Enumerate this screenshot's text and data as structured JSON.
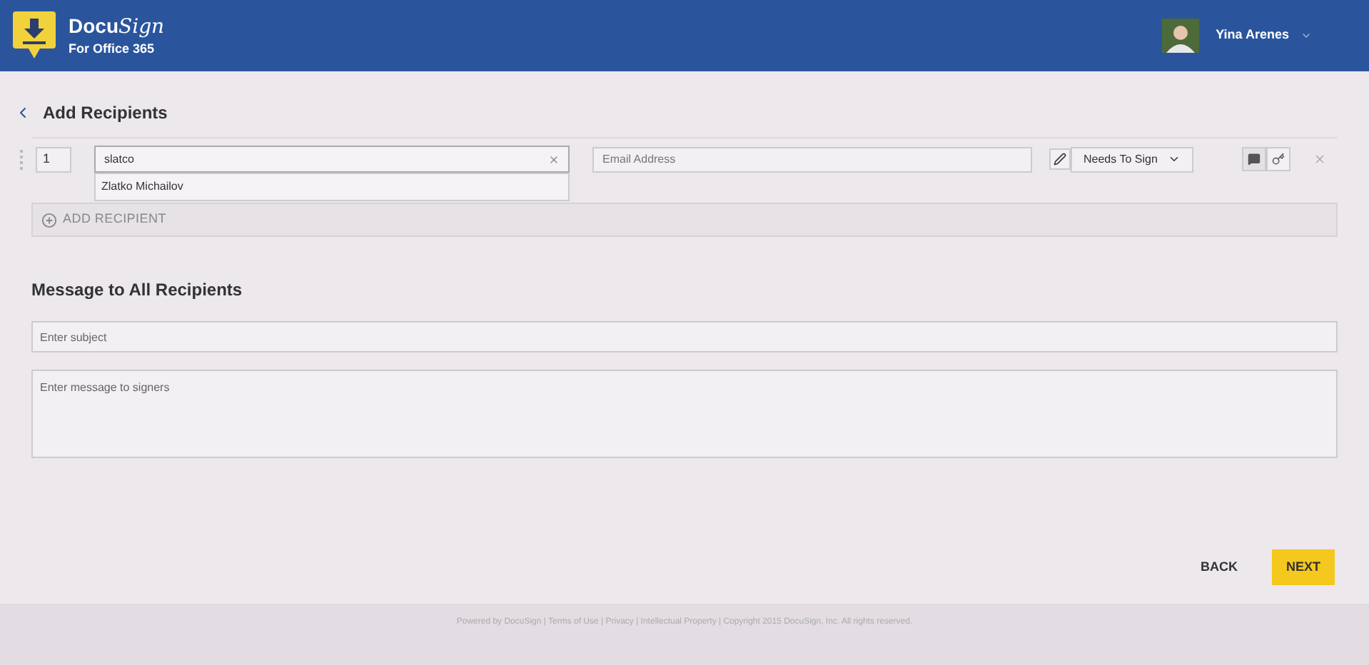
{
  "header": {
    "brand": "Docu",
    "brand_script": "Sign",
    "subtitle": "For Office 365",
    "user": "Yina Arenes"
  },
  "page_title": "Add Recipients",
  "recipients": [
    {
      "order": "1",
      "name": "slatco",
      "email_placeholder": "Email Address",
      "action": "Needs To Sign",
      "suggestions": [
        "Zlatko Michailov"
      ]
    }
  ],
  "add_recipient": "ADD RECIPIENT",
  "message": {
    "title": "Message to All Recipients",
    "subject_placeholder": "Enter subject",
    "body_placeholder": "Enter message to signers"
  },
  "buttons": {
    "back": "BACK",
    "next": "NEXT"
  },
  "footer": "Powered by DocuSign | Terms of Use | Privacy | Intellectual Property | Copyright 2015 DocuSign, Inc. All rights reserved."
}
